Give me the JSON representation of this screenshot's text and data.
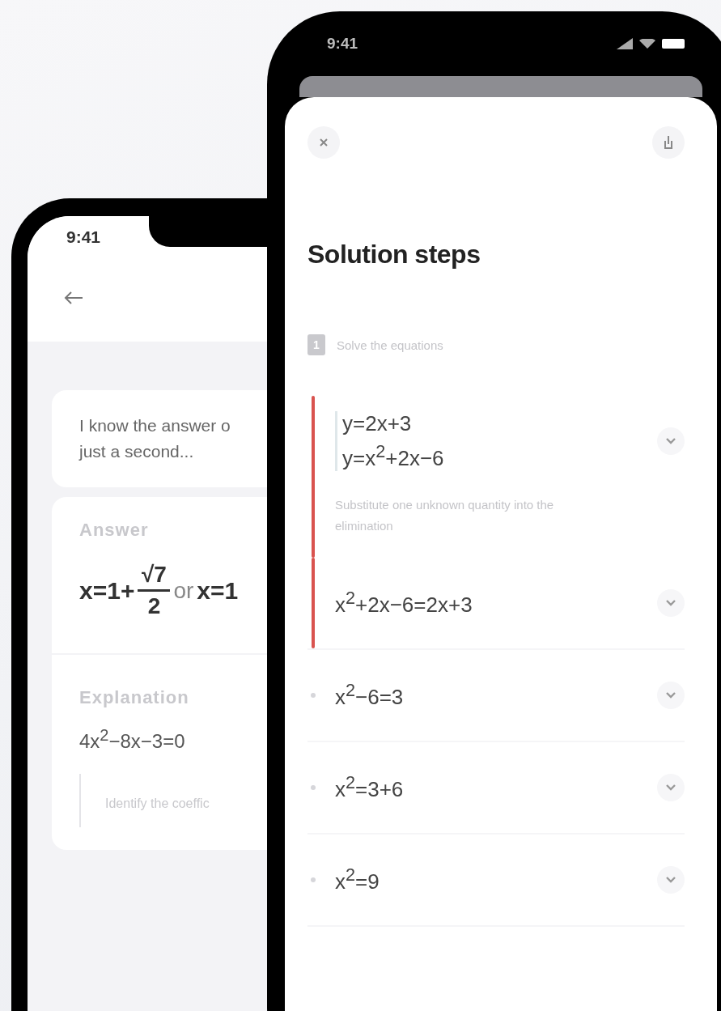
{
  "back_phone": {
    "time": "9:41",
    "message": "I know the answer o\njust a second...",
    "answer": {
      "label": "Answer",
      "prefix": "x=1+",
      "numerator": "√7",
      "denominator": "2",
      "middle": "or",
      "suffix": "x=1"
    },
    "explanation": {
      "label": "Explanation",
      "equation": "4x$^{2}$−8x−3=0",
      "note": "Identify the coeffic"
    }
  },
  "front_phone": {
    "time": "9:41",
    "title": "Solution steps",
    "step_number": "1",
    "step_title": "Solve the equations",
    "steps": [
      {
        "kind": "system",
        "lines": [
          "y=2x+3",
          "y=x$^{2}$+2x−6"
        ],
        "highlighted": true,
        "note": "Substitute one unknown quantity into the elimination"
      },
      {
        "kind": "equation",
        "text": "x$^{2}$+2x−6=2x+3",
        "highlighted": true
      },
      {
        "kind": "equation",
        "text": "x$^{2}$−6=3",
        "highlighted": false
      },
      {
        "kind": "equation",
        "text": "x$^{2}$=3+6",
        "highlighted": false
      },
      {
        "kind": "equation",
        "text": "x$^{2}$=9",
        "highlighted": false
      }
    ]
  }
}
